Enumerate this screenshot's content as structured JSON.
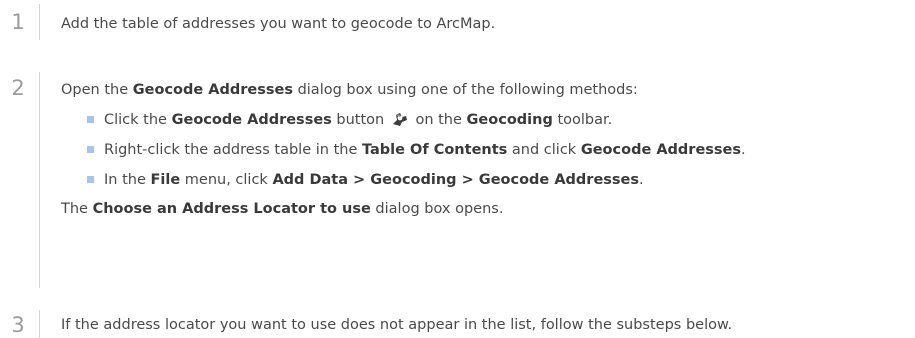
{
  "steps": [
    {
      "number": "1",
      "text": "Add the table of addresses you want to geocode to ArcMap."
    },
    {
      "number": "2",
      "intro": {
        "t1": "Open the ",
        "b1": "Geocode Addresses",
        "t2": " dialog box using one of the following methods:"
      },
      "bullets": [
        {
          "t1": "Click the ",
          "b1": "Geocode Addresses",
          "t2": " button ",
          "icon": "geocode-addresses-icon",
          "t3": " on the ",
          "b2": "Geocoding",
          "t4": " toolbar."
        },
        {
          "t1": "Right-click the address table in the ",
          "b1": "Table Of Contents",
          "t2": " and click ",
          "b2": "Geocode Addresses",
          "t3": "."
        },
        {
          "t1": "In the ",
          "b1": "File",
          "t2": " menu, click ",
          "b2": "Add Data > Geocoding > Geocode Addresses",
          "t3": "."
        }
      ],
      "outro": {
        "t1": "The ",
        "b1": "Choose an Address Locator to use",
        "t2": " dialog box opens."
      }
    },
    {
      "number": "3",
      "text": "If the address locator you want to use does not appear in the list, follow the substeps below."
    }
  ],
  "colors": {
    "text": "#4a4a4a",
    "number": "#9b9b9b",
    "rule": "#d4d4d4",
    "bullet": "#a9c4e6"
  }
}
